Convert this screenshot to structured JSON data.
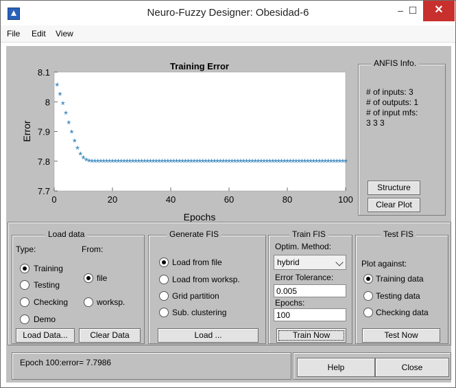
{
  "window": {
    "title": "Neuro-Fuzzy Designer: Obesidad-6",
    "min_glyph": "–",
    "max_glyph": "☐",
    "close_glyph": "✕"
  },
  "menu": [
    "File",
    "Edit",
    "View"
  ],
  "chart_data": {
    "type": "scatter",
    "title": "Training Error",
    "xlabel": "Epochs",
    "ylabel": "Error",
    "xlim": [
      0,
      100
    ],
    "ylim": [
      7.7,
      8.1
    ],
    "xticks": [
      "0",
      "20",
      "40",
      "60",
      "80",
      "100"
    ],
    "yticks": [
      "7.7",
      "7.8",
      "7.9",
      "8",
      "8.1"
    ],
    "marker": "*",
    "color": "#1f77b4",
    "x": [
      1,
      2,
      3,
      4,
      5,
      6,
      7,
      8,
      9,
      10,
      11,
      12,
      13,
      14,
      15,
      16,
      17,
      18,
      19,
      20,
      21,
      22,
      23,
      24,
      25,
      26,
      27,
      28,
      29,
      30,
      31,
      32,
      33,
      34,
      35,
      36,
      37,
      38,
      39,
      40,
      41,
      42,
      43,
      44,
      45,
      46,
      47,
      48,
      49,
      50,
      51,
      52,
      53,
      54,
      55,
      56,
      57,
      58,
      59,
      60,
      61,
      62,
      63,
      64,
      65,
      66,
      67,
      68,
      69,
      70,
      71,
      72,
      73,
      74,
      75,
      76,
      77,
      78,
      79,
      80,
      81,
      82,
      83,
      84,
      85,
      86,
      87,
      88,
      89,
      90,
      91,
      92,
      93,
      94,
      95,
      96,
      97,
      98,
      99,
      100
    ],
    "y": [
      8.055,
      8.024,
      7.992,
      7.96,
      7.928,
      7.896,
      7.866,
      7.842,
      7.823,
      7.81,
      7.803,
      7.8,
      7.7986,
      7.7986,
      7.7986,
      7.7986,
      7.7986,
      7.7986,
      7.7986,
      7.7986,
      7.7986,
      7.7986,
      7.7986,
      7.7986,
      7.7986,
      7.7986,
      7.7986,
      7.7986,
      7.7986,
      7.7986,
      7.7986,
      7.7986,
      7.7986,
      7.7986,
      7.7986,
      7.7986,
      7.7986,
      7.7986,
      7.7986,
      7.7986,
      7.7986,
      7.7986,
      7.7986,
      7.7986,
      7.7986,
      7.7986,
      7.7986,
      7.7986,
      7.7986,
      7.7986,
      7.7986,
      7.7986,
      7.7986,
      7.7986,
      7.7986,
      7.7986,
      7.7986,
      7.7986,
      7.7986,
      7.7986,
      7.7986,
      7.7986,
      7.7986,
      7.7986,
      7.7986,
      7.7986,
      7.7986,
      7.7986,
      7.7986,
      7.7986,
      7.7986,
      7.7986,
      7.7986,
      7.7986,
      7.7986,
      7.7986,
      7.7986,
      7.7986,
      7.7986,
      7.7986,
      7.7986,
      7.7986,
      7.7986,
      7.7986,
      7.7986,
      7.7986,
      7.7986,
      7.7986,
      7.7986,
      7.7986,
      7.7986,
      7.7986,
      7.7986,
      7.7986,
      7.7986,
      7.7986,
      7.7986,
      7.7986,
      7.7986,
      7.7986
    ]
  },
  "anfis_info": {
    "title": "ANFIS Info.",
    "lines": [
      "# of inputs: 3",
      "# of outputs: 1",
      "# of input mfs:",
      "3  3  3"
    ],
    "structure_button": "Structure",
    "clear_plot_button": "Clear Plot"
  },
  "load_data": {
    "title": "Load data",
    "type_label": "Type:",
    "from_label": "From:",
    "type_options": [
      {
        "label": "Training",
        "checked": true
      },
      {
        "label": "Testing",
        "checked": false
      },
      {
        "label": "Checking",
        "checked": false
      },
      {
        "label": "Demo",
        "checked": false
      }
    ],
    "from_options": [
      {
        "label": "file",
        "checked": true
      },
      {
        "label": "worksp.",
        "checked": false
      }
    ],
    "load_button": "Load Data...",
    "clear_button": "Clear Data"
  },
  "generate_fis": {
    "title": "Generate FIS",
    "options": [
      {
        "label": "Load from file",
        "checked": true
      },
      {
        "label": "Load from worksp.",
        "checked": false
      },
      {
        "label": "Grid partition",
        "checked": false
      },
      {
        "label": "Sub. clustering",
        "checked": false
      }
    ],
    "load_button": "Load ..."
  },
  "train_fis": {
    "title": "Train FIS",
    "method_label": "Optim. Method:",
    "method_value": "hybrid",
    "tolerance_label": "Error Tolerance:",
    "tolerance_value": "0.005",
    "epochs_label": "Epochs:",
    "epochs_value": "100",
    "train_button": "Train Now"
  },
  "test_fis": {
    "title": "Test FIS",
    "plot_against_label": "Plot against:",
    "options": [
      {
        "label": "Training data",
        "checked": true
      },
      {
        "label": "Testing data",
        "checked": false
      },
      {
        "label": "Checking data",
        "checked": false
      }
    ],
    "test_button": "Test Now"
  },
  "status": {
    "text": "Epoch 100:error= 7.7986"
  },
  "help_button": "Help",
  "close_button": "Close"
}
